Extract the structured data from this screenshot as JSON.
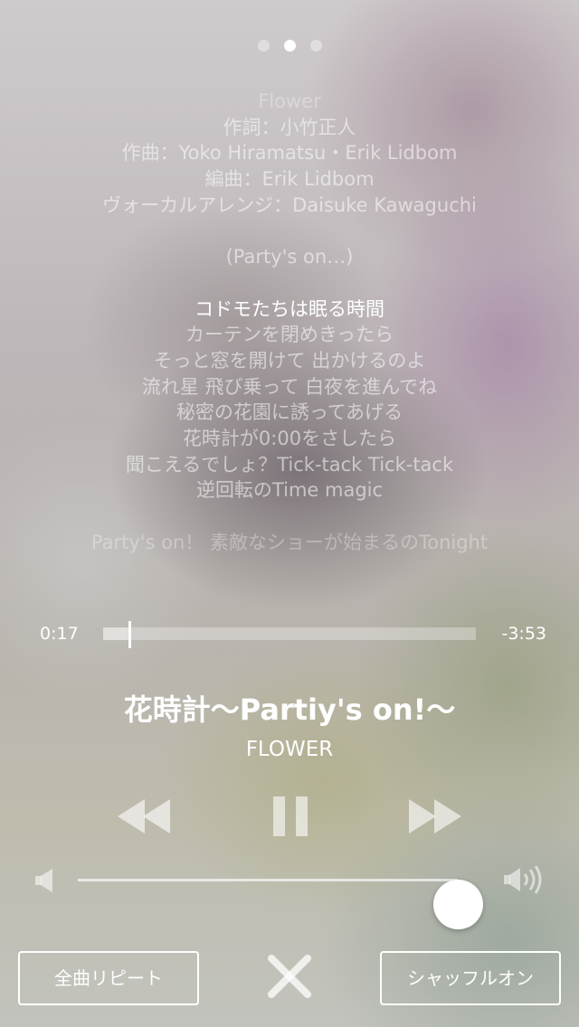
{
  "pager": {
    "count": 3,
    "active_index": 1
  },
  "lyrics": {
    "lines": [
      {
        "text": "Flower",
        "style": "dim"
      },
      {
        "text": "作詞：小竹正人",
        "style": "normal"
      },
      {
        "text": "作曲：Yoko Hiramatsu・Erik Lidbom",
        "style": "normal"
      },
      {
        "text": "編曲：Erik Lidbom",
        "style": "normal"
      },
      {
        "text": "ヴォーカルアレンジ：Daisuke Kawaguchi",
        "style": "normal"
      },
      {
        "text": "",
        "style": "blank"
      },
      {
        "text": "(Party's on…)",
        "style": "normal"
      },
      {
        "text": "",
        "style": "blank"
      },
      {
        "text": "コドモたちは眠る時間",
        "style": "current"
      },
      {
        "text": "カーテンを閉めきったら",
        "style": "normal"
      },
      {
        "text": "そっと窓を開けて 出かけるのよ",
        "style": "normal"
      },
      {
        "text": "流れ星 飛び乗って 白夜を進んでね",
        "style": "normal"
      },
      {
        "text": "秘密の花園に誘ってあげる",
        "style": "normal"
      },
      {
        "text": "花時計が0:00をさしたら",
        "style": "normal"
      },
      {
        "text": "聞こえるでしょ？Tick-tack Tick-tack",
        "style": "normal"
      },
      {
        "text": "逆回転のTime magic",
        "style": "normal"
      },
      {
        "text": "",
        "style": "blank"
      },
      {
        "text": "Party's on！ 素敵なショーが始まるのTonight",
        "style": "dim"
      }
    ]
  },
  "playback": {
    "elapsed": "0:17",
    "remaining": "-3:53",
    "progress_fraction": 0.07
  },
  "track": {
    "title": "花時計〜Partiy's on!〜",
    "artist": "FLOWER"
  },
  "controls": {
    "rewind_icon": "rewind-icon",
    "pause_icon": "pause-icon",
    "forward_icon": "fast-forward-icon"
  },
  "volume": {
    "level_fraction": 1.0,
    "low_icon": "speaker-low-icon",
    "high_icon": "speaker-high-icon"
  },
  "bottom": {
    "repeat_label": "全曲リピート",
    "shuffle_label": "シャッフルオン",
    "close_icon": "close-icon"
  },
  "colors": {
    "foreground": "#ffffff"
  }
}
